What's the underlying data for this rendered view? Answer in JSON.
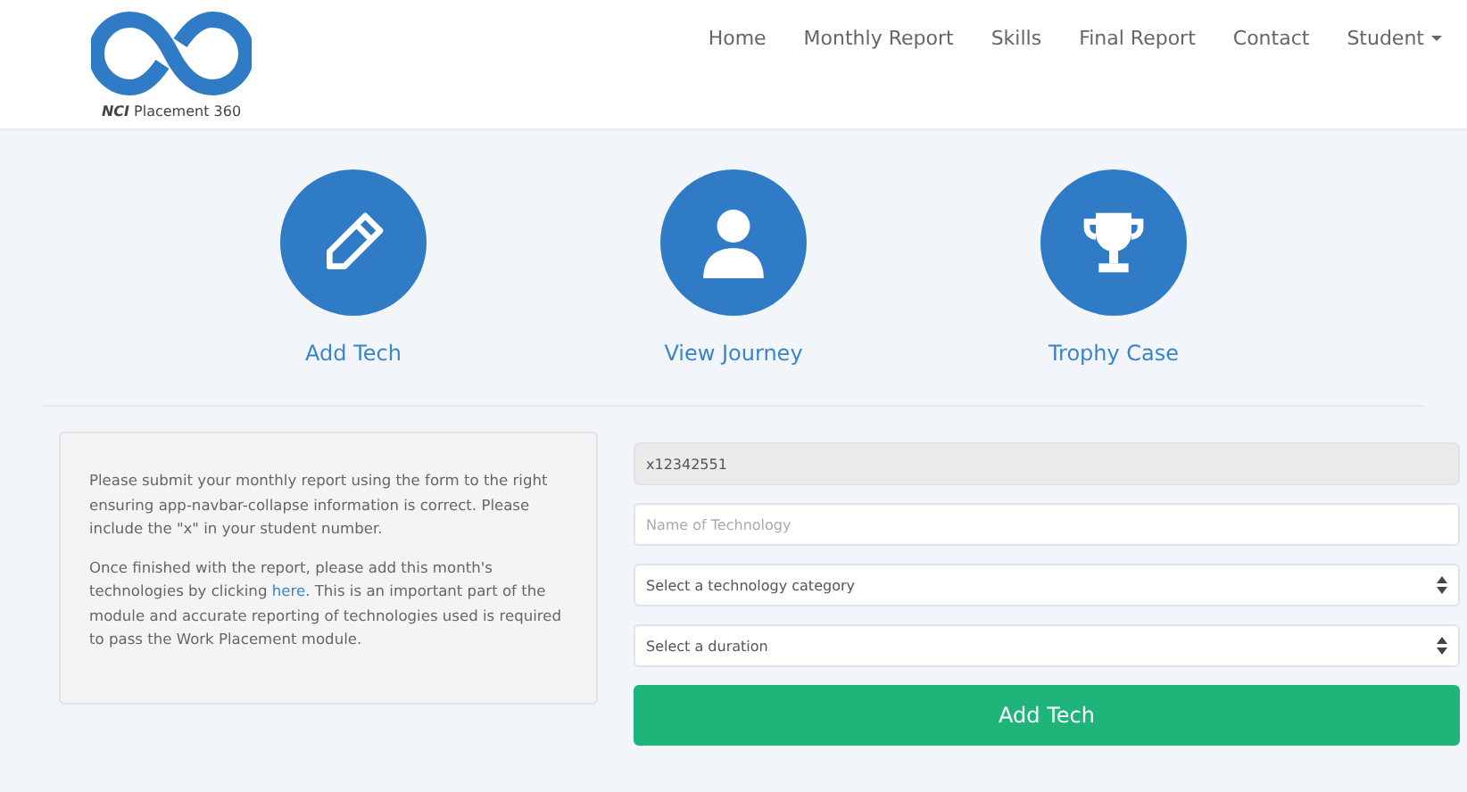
{
  "brand": {
    "bold": "NCI",
    "text": "Placement 360"
  },
  "nav": [
    {
      "label": "Home",
      "dropdown": false
    },
    {
      "label": "Monthly Report",
      "dropdown": false
    },
    {
      "label": "Skills",
      "dropdown": false
    },
    {
      "label": "Final Report",
      "dropdown": false
    },
    {
      "label": "Contact",
      "dropdown": false
    },
    {
      "label": "Student",
      "dropdown": true
    }
  ],
  "actions": [
    {
      "kind": "pencil",
      "label": "Add Tech"
    },
    {
      "kind": "user",
      "label": "View Journey"
    },
    {
      "kind": "trophy",
      "label": "Trophy Case"
    }
  ],
  "info": {
    "paragraphs": [
      {
        "before": "Please submit your monthly report using the form to the right ensuring app-navbar-collapse information is correct. Please include the \"x\" in your student number."
      },
      {
        "before": "Once finished with the report, please add this month's technologies by clicking ",
        "link": "here",
        "after": ". This is an important part of the module and accurate reporting of technologies used is required to pass the Work Placement module."
      }
    ]
  },
  "form": {
    "fields": [
      {
        "kind": "input",
        "value": "x12342551",
        "disabled": true
      },
      {
        "kind": "input",
        "placeholder": "Name of Technology",
        "disabled": false
      },
      {
        "kind": "select",
        "value": "Select a technology category",
        "disabled": false
      },
      {
        "kind": "select",
        "value": "Select a duration",
        "disabled": false
      }
    ],
    "submit": "Add Tech"
  }
}
